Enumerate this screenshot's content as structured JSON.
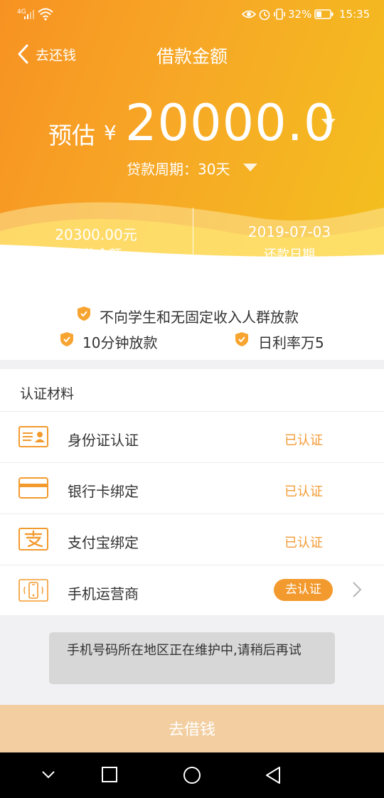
{
  "status_bar": {
    "signal_label": "4G",
    "battery": "32%",
    "time": "15:35"
  },
  "nav": {
    "back_label": "去还钱",
    "title": "借款金额"
  },
  "loan": {
    "estimate_prefix": "预估",
    "currency": "¥",
    "amount": "20000.0",
    "period_label": "贷款周期：30天"
  },
  "summary": {
    "repay_amount_value": "20300.00元",
    "repay_amount_label": "还款金额",
    "repay_date_value": "2019-07-03",
    "repay_date_label": "还款日期"
  },
  "features": [
    "不向学生和无固定收入人群放款",
    "10分钟放款",
    "日利率万5"
  ],
  "verification": {
    "section_title": "认证材料",
    "items": [
      {
        "label": "身份证认证",
        "status": "已认证",
        "icon": "id-card-icon"
      },
      {
        "label": "银行卡绑定",
        "status": "已认证",
        "icon": "bank-card-icon"
      },
      {
        "label": "支付宝绑定",
        "status": "已认证",
        "icon": "alipay-icon"
      },
      {
        "label": "手机运营商",
        "status": "去认证",
        "icon": "phone-icon"
      }
    ]
  },
  "toast": "手机号码所在地区正在维护中,请稍后再试",
  "borrow_button": "去借钱",
  "colors": {
    "accent": "#f39a2e",
    "header_start": "#f79222",
    "header_end": "#f3c01e",
    "button_disabled": "#f2cea0"
  }
}
